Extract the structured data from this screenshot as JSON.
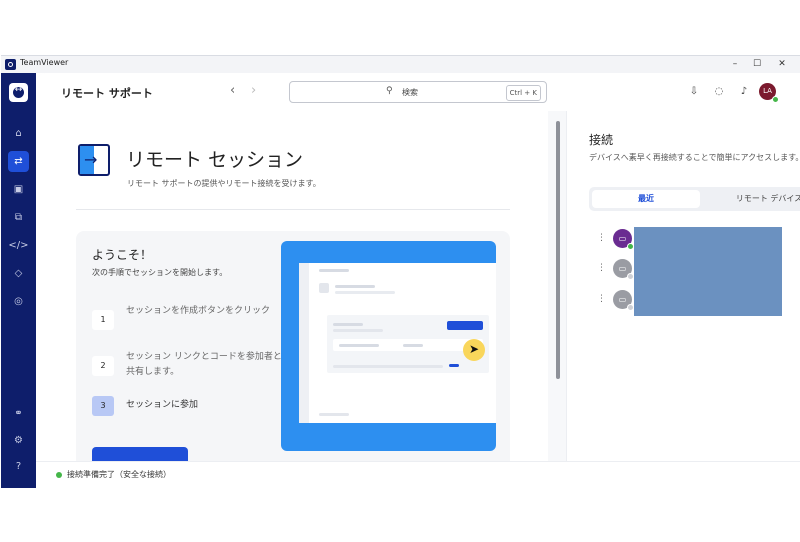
{
  "window": {
    "title": "TeamViewer"
  },
  "window_controls": {
    "minimize": "–",
    "maximize": "☐",
    "close": "✕"
  },
  "header": {
    "title": "リモート サポート",
    "search_placeholder": "検索",
    "search_shortcut": "Ctrl + K",
    "avatar_initials": "LA"
  },
  "session": {
    "title": "リモート セッション",
    "subtitle": "リモート サポートの提供やリモート接続を受けます。"
  },
  "welcome": {
    "title": "ようこそ！",
    "subtitle": "次の手順でセッションを開始します。",
    "steps": [
      {
        "num": "1",
        "text": "セッションを作成ボタンをクリック"
      },
      {
        "num": "2",
        "text": "セッション リンクとコードを参加者と共有します。"
      },
      {
        "num": "3",
        "text": "セッションに参加"
      }
    ]
  },
  "connections": {
    "title": "接続",
    "description": "デバイスへ素早く再接続することで簡単にアクセスします。",
    "tabs": [
      "最近",
      "リモート デバイス"
    ]
  },
  "status": {
    "text": "接続準備完了（安全な接続）",
    "color": "#44b649"
  },
  "colors": {
    "rail": "#0e1e6b",
    "accent": "#1f4fd8",
    "illustration": "#2d8ff0",
    "device_purple": "#6a2c91"
  }
}
